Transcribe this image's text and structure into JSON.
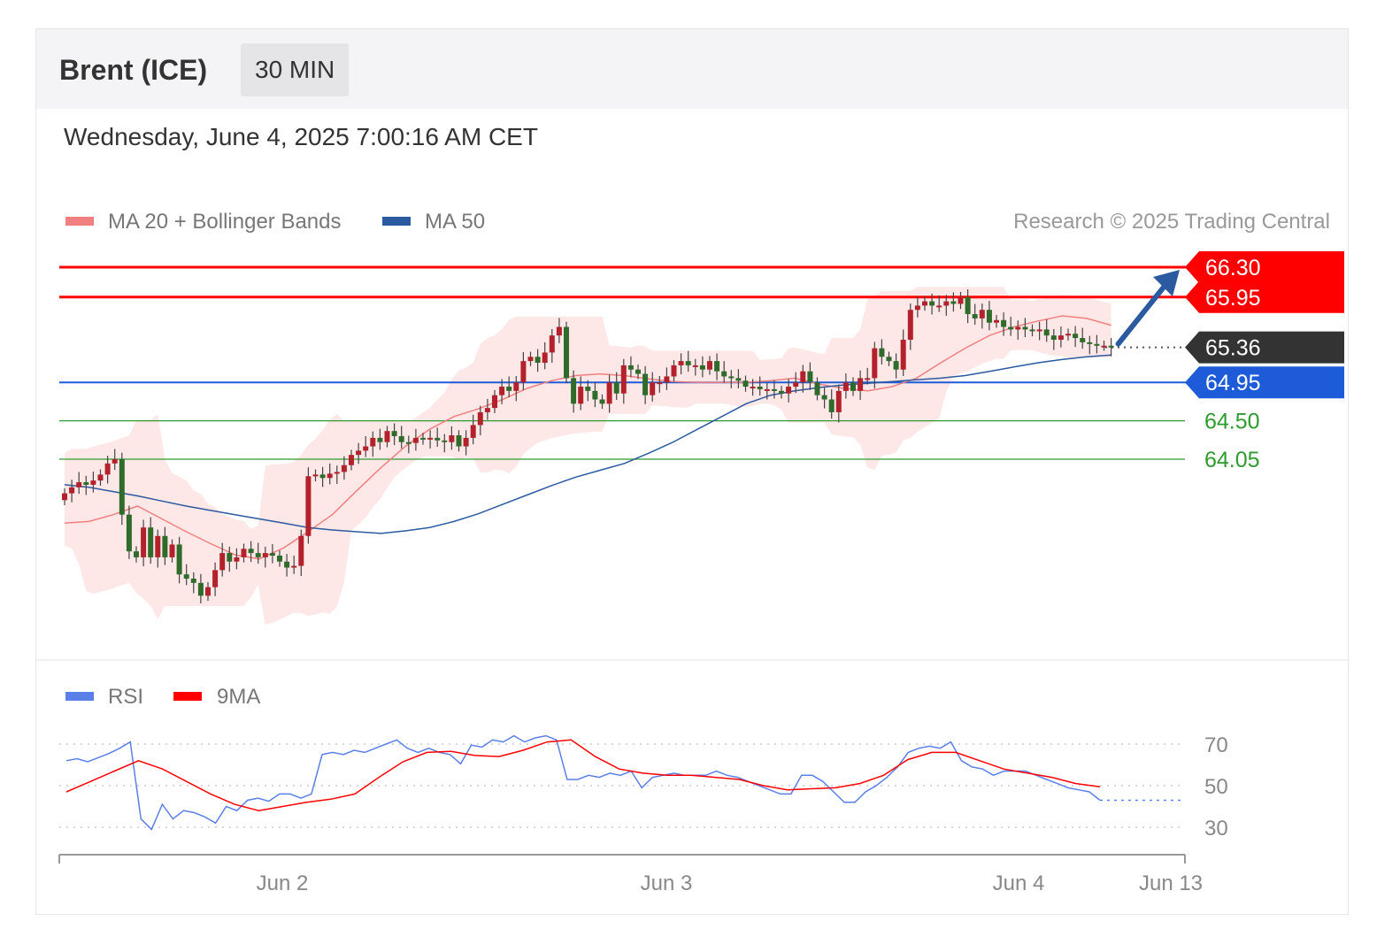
{
  "header": {
    "title": "Brent (ICE)",
    "timeframe": "30 MIN"
  },
  "datetime": "Wednesday, June 4, 2025 7:00:16 AM CET",
  "legend": {
    "ma20": {
      "label": "MA 20 + Bollinger Bands",
      "color": "#f08080"
    },
    "ma50": {
      "label": "MA 50",
      "color": "#2c5aa0"
    },
    "credit": "Research © 2025 Trading Central"
  },
  "rsi_legend": {
    "rsi": {
      "label": "RSI",
      "color": "#5b7fe8"
    },
    "ma9": {
      "label": "9MA",
      "color": "#ff0000"
    }
  },
  "colors": {
    "up": "#b3222c",
    "down": "#2f6b2a",
    "resistance": "#ff0000",
    "pivot": "#1e5bd8",
    "support": "#2e9b2e",
    "last": "#333333",
    "band": "#fde3e3"
  },
  "chart_data": [
    {
      "type": "candlestick",
      "title": "Brent (ICE)",
      "xlabel": "",
      "ylabel": "",
      "ylim": [
        62.5,
        66.8
      ],
      "x_ticks": [
        "Jun 2",
        "Jun 3",
        "Jun 4",
        "Jun 13"
      ],
      "price_levels": [
        {
          "value": 66.3,
          "label": "66.30",
          "role": "resistance"
        },
        {
          "value": 65.95,
          "label": "65.95",
          "role": "resistance"
        },
        {
          "value": 65.36,
          "label": "65.36",
          "role": "last"
        },
        {
          "value": 64.95,
          "label": "64.95",
          "role": "pivot"
        },
        {
          "value": 64.5,
          "label": "64.50",
          "role": "support"
        },
        {
          "value": 64.05,
          "label": "64.05",
          "role": "support"
        }
      ],
      "close": [
        63.65,
        63.72,
        63.78,
        63.75,
        63.8,
        63.87,
        64.0,
        64.05,
        63.4,
        62.97,
        62.9,
        63.25,
        62.9,
        63.15,
        62.9,
        63.05,
        62.7,
        62.65,
        62.6,
        62.45,
        62.55,
        62.75,
        62.95,
        62.85,
        62.9,
        63.0,
        62.95,
        62.9,
        62.95,
        62.92,
        62.85,
        62.78,
        62.8,
        63.15,
        63.85,
        63.87,
        63.83,
        63.88,
        63.9,
        63.98,
        64.1,
        64.15,
        64.2,
        64.3,
        64.25,
        64.38,
        64.32,
        64.25,
        64.24,
        64.3,
        64.28,
        64.3,
        64.27,
        64.25,
        64.33,
        64.2,
        64.3,
        64.45,
        64.6,
        64.65,
        64.8,
        64.9,
        64.85,
        64.95,
        65.2,
        65.25,
        65.18,
        65.3,
        65.5,
        65.6,
        65.0,
        64.7,
        64.9,
        64.85,
        64.75,
        64.7,
        64.95,
        64.82,
        65.15,
        65.1,
        65.05,
        64.8,
        64.95,
        64.95,
        65.02,
        65.15,
        65.2,
        65.15,
        65.15,
        65.1,
        65.2,
        65.08,
        65.02,
        65.0,
        64.97,
        64.9,
        64.9,
        64.87,
        64.87,
        64.85,
        64.82,
        64.9,
        64.95,
        65.08,
        64.95,
        64.8,
        64.75,
        64.6,
        64.85,
        64.95,
        64.85,
        65.0,
        65.0,
        65.35,
        65.25,
        65.2,
        65.1,
        65.45,
        65.8,
        65.85,
        65.9,
        65.85,
        65.85,
        65.9,
        65.87,
        65.95,
        65.75,
        65.7,
        65.8,
        65.65,
        65.68,
        65.6,
        65.57,
        65.6,
        65.57,
        65.55,
        65.57,
        65.5,
        65.45,
        65.5,
        65.52,
        65.47,
        65.42,
        65.4,
        65.38,
        65.38,
        65.36
      ],
      "ma50": [
        63.75,
        63.72,
        63.67,
        63.62,
        63.56,
        63.5,
        63.45,
        63.4,
        63.35,
        63.3,
        63.25,
        63.22,
        63.2,
        63.18,
        63.21,
        63.25,
        63.32,
        63.41,
        63.52,
        63.63,
        63.74,
        63.84,
        63.92,
        64.0,
        64.12,
        64.25,
        64.4,
        64.55,
        64.7,
        64.8,
        64.85,
        64.89,
        64.92,
        64.94,
        64.96,
        64.98,
        65.0,
        65.03,
        65.08,
        65.13,
        65.18,
        65.22,
        65.25,
        65.27
      ],
      "ma20": [
        63.3,
        63.32,
        63.4,
        63.5,
        63.35,
        63.2,
        63.06,
        62.93,
        62.88,
        63.01,
        63.2,
        63.4,
        63.68,
        63.95,
        64.2,
        64.4,
        64.55,
        64.64,
        64.75,
        64.88,
        64.97,
        65.03,
        65.05,
        65.03,
        64.99,
        64.96,
        64.95,
        64.95,
        64.95,
        64.97,
        65.0,
        64.93,
        64.88,
        64.85,
        64.9,
        65.0,
        65.18,
        65.35,
        65.5,
        65.6,
        65.67,
        65.73,
        65.7,
        65.62
      ]
    },
    {
      "type": "line",
      "title": "",
      "xlabel": "",
      "ylabel": "",
      "ylim": [
        20,
        80
      ],
      "y_ticks": [
        30,
        50,
        70
      ],
      "series": [
        {
          "name": "RSI",
          "values": [
            62.0,
            63.0,
            61.5,
            63.5,
            65.5,
            68.0,
            71.0,
            34.0,
            29.0,
            41.0,
            34.0,
            38.0,
            37.0,
            35.0,
            32.0,
            40.0,
            38.0,
            43.0,
            44.0,
            42.5,
            46.0,
            46.0,
            44.0,
            46.0,
            65.0,
            66.0,
            65.0,
            67.0,
            66.0,
            68.0,
            70.0,
            72.0,
            68.0,
            66.0,
            68.0,
            66.0,
            65.0,
            60.5,
            69.5,
            68.5,
            72.0,
            71.0,
            74.0,
            71.0,
            73.0,
            74.0,
            72.0,
            53.0,
            53.0,
            55.0,
            54.0,
            56.0,
            55.0,
            57.0,
            49.0,
            54.0,
            55.0,
            56.0,
            55.0,
            55.0,
            55.0,
            57.0,
            55.0,
            54.0,
            52.0,
            50.0,
            48.0,
            46.0,
            46.0,
            55.0,
            55.0,
            52.0,
            47.0,
            42.0,
            42.0,
            47.0,
            50.0,
            54.0,
            59.0,
            66.0,
            68.0,
            69.0,
            68.0,
            71.0,
            62.0,
            59.0,
            58.0,
            55.0,
            57.0,
            57.0,
            57.0,
            55.0,
            53.0,
            51.0,
            49.0,
            48.0,
            47.0,
            43.0
          ]
        },
        {
          "name": "9MA",
          "values": [
            47.0,
            52.0,
            57.0,
            62.0,
            58.0,
            52.0,
            46.0,
            41.0,
            38.0,
            40.0,
            42.0,
            43.5,
            46.0,
            54.0,
            61.5,
            66.0,
            66.5,
            64.5,
            64.0,
            67.0,
            71.0,
            72.0,
            64.0,
            58.0,
            56.0,
            55.0,
            55.0,
            54.0,
            53.0,
            50.0,
            48.0,
            48.5,
            49.0,
            51.0,
            55.0,
            62.5,
            66.0,
            66.0,
            62.0,
            58.0,
            56.0,
            54.0,
            51.0,
            49.5
          ]
        }
      ]
    }
  ]
}
